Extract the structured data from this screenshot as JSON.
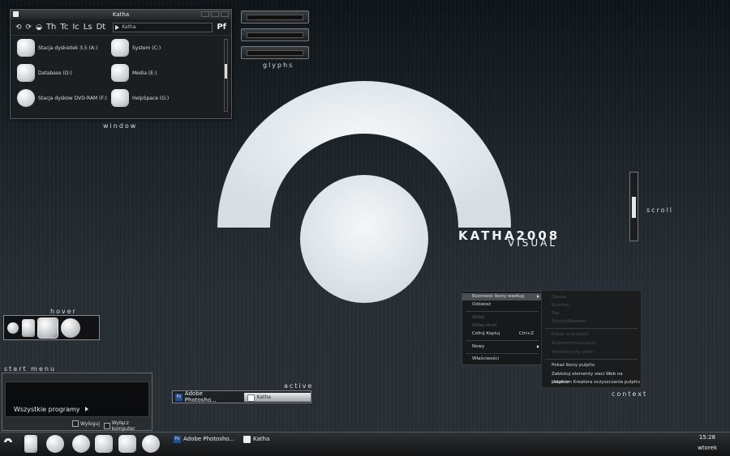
{
  "colors": {
    "accent": "#e7edf2",
    "menu_highlight": "#4b4f53",
    "background": "#1d252b"
  },
  "labels": {
    "window": "window",
    "glyphs": "glyphs",
    "scroll": "scroll",
    "hover": "hover",
    "start_menu": "start menu",
    "active": "active",
    "context": "context"
  },
  "brand": {
    "line1": "KATHA2008",
    "line2": "VISUAL"
  },
  "window": {
    "title": "Katha",
    "toolbar": [
      "Th",
      "Tc",
      "Ic",
      "Ls",
      "Dt"
    ],
    "address": "Katha",
    "pf": "Pf",
    "drives": [
      {
        "label": "Stacja dyskietek 3,5 (A:)"
      },
      {
        "label": "System (C:)"
      },
      {
        "label": "Database (D:)"
      },
      {
        "label": "Media (E:)"
      },
      {
        "label": "Stacja dysków DVD-RAM (F:)"
      },
      {
        "label": "HelpSpace (G:)"
      }
    ]
  },
  "start_menu": {
    "all_programs": "Wszystkie programy",
    "logout": "Wyloguj",
    "shutdown": "Wyłącz komputer"
  },
  "active_bar": {
    "item1": "Adobe Photosho...",
    "item2": "Katha"
  },
  "context_menu": {
    "items": [
      {
        "label": "Rozmieść ikony według",
        "state": "selected"
      },
      {
        "label": "Odśwież",
        "state": "normal"
      },
      {
        "label": "Wklej",
        "state": "disabled"
      },
      {
        "label": "Wklej skrót",
        "state": "disabled"
      },
      {
        "label": "Cofnij Kopiuj",
        "shortcut": "Ctrl+Z",
        "state": "normal"
      },
      {
        "label": "Nowy",
        "state": "normal"
      },
      {
        "label": "Właściwości",
        "state": "normal"
      }
    ]
  },
  "submenu": {
    "items": [
      {
        "label": "Nazwa",
        "state": "disabled"
      },
      {
        "label": "Rozmiar",
        "state": "disabled"
      },
      {
        "label": "Typ",
        "state": "disabled"
      },
      {
        "label": "Zmodyfikowany",
        "state": "disabled"
      },
      {
        "label": "Pokaż w grupach",
        "state": "disabled"
      },
      {
        "label": "Autorozmieszczanie",
        "state": "disabled"
      },
      {
        "label": "Wyrównaj do siatki",
        "state": "disabled"
      },
      {
        "label": "Pokaż ikony pulpitu",
        "state": "normal"
      },
      {
        "label": "Zablokuj elementy sieci Web na pulpicie",
        "state": "normal"
      },
      {
        "label": "Uruchom Kreatora oczyszczania pulpitu",
        "state": "normal"
      }
    ]
  },
  "taskbar": {
    "tasks": [
      {
        "label": "Adobe Photosho..."
      },
      {
        "label": "Katha"
      }
    ],
    "clock_time": "15:28",
    "clock_day": "wtorek"
  }
}
